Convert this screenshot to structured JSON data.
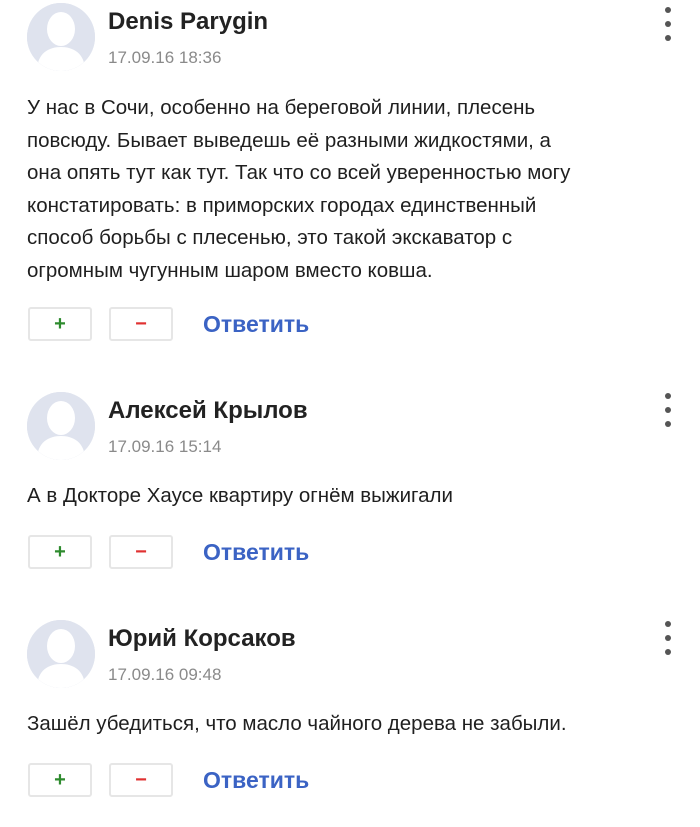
{
  "comments": [
    {
      "author": "Denis Parygin",
      "date": "17.09.16 18:36",
      "text_lines": [
        "У нас в Сочи, особенно на береговой линии, плесень",
        "повсюду. Бывает выведешь её разными жидкостями, а",
        "она опять тут как тут. Так что со всей уверенностью могу",
        "констатировать: в приморских городах единственный",
        "способ борьбы с плесенью, это такой экскаватор с",
        "огромным чугунным шаром вместо ковша."
      ],
      "plus_label": "+",
      "minus_label": "−",
      "reply_label": "Ответить"
    },
    {
      "author": "Алексей Крылов",
      "date": "17.09.16 15:14",
      "text_lines": [
        "А в Докторе Хаусе квартиру огнём выжигали"
      ],
      "plus_label": "+",
      "minus_label": "−",
      "reply_label": "Ответить"
    },
    {
      "author": "Юрий Корсаков",
      "date": "17.09.16 09:48",
      "text_lines": [
        "Зашёл убедиться, что масло чайного дерева не забыли."
      ],
      "plus_label": "+",
      "minus_label": "−",
      "reply_label": "Ответить"
    }
  ],
  "icons": {
    "avatar": "default-user-silhouette",
    "menu": "more-vertical-dots"
  },
  "colors": {
    "plus": "#2e8b2e",
    "minus": "#e03131",
    "reply": "#3b63c4",
    "date": "#8a8a8a",
    "avatar_bg": "#dfe3ee"
  }
}
